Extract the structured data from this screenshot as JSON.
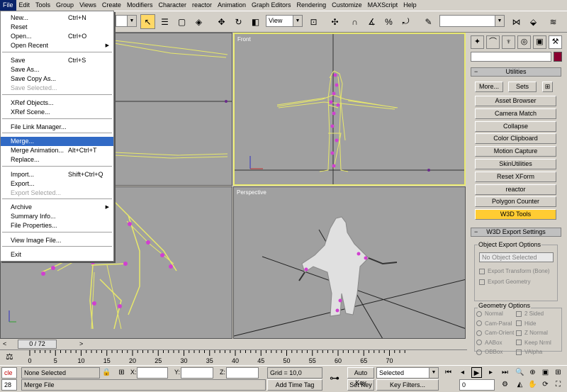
{
  "menubar": {
    "items": [
      "File",
      "Edit",
      "Tools",
      "Group",
      "Views",
      "Create",
      "Modifiers",
      "Character",
      "reactor",
      "Animation",
      "Graph Editors",
      "Rendering",
      "Customize",
      "MAXScript",
      "Help"
    ]
  },
  "toolbar": {
    "view_dropdown": "View"
  },
  "file_menu": {
    "items": [
      {
        "label": "New...",
        "shortcut": "Ctrl+N"
      },
      {
        "label": "Reset",
        "shortcut": ""
      },
      {
        "label": "Open...",
        "shortcut": "Ctrl+O"
      },
      {
        "label": "Open Recent",
        "shortcut": ""
      },
      {
        "label": "Save",
        "shortcut": "Ctrl+S"
      },
      {
        "label": "Save As...",
        "shortcut": ""
      },
      {
        "label": "Save Copy As...",
        "shortcut": ""
      },
      {
        "label": "Save Selected...",
        "shortcut": ""
      },
      {
        "label": "XRef Objects...",
        "shortcut": ""
      },
      {
        "label": "XRef Scene...",
        "shortcut": ""
      },
      {
        "label": "File Link Manager...",
        "shortcut": ""
      },
      {
        "label": "Merge...",
        "shortcut": ""
      },
      {
        "label": "Merge Animation...",
        "shortcut": "Alt+Ctrl+T"
      },
      {
        "label": "Replace...",
        "shortcut": ""
      },
      {
        "label": "Import...",
        "shortcut": "Shift+Ctrl+Q"
      },
      {
        "label": "Export...",
        "shortcut": ""
      },
      {
        "label": "Export Selected...",
        "shortcut": ""
      },
      {
        "label": "Archive",
        "shortcut": ""
      },
      {
        "label": "Summary Info...",
        "shortcut": ""
      },
      {
        "label": "File Properties...",
        "shortcut": ""
      },
      {
        "label": "View Image File...",
        "shortcut": ""
      },
      {
        "label": "Exit",
        "shortcut": ""
      }
    ]
  },
  "viewports": {
    "front_label": "Front",
    "perspective_label": "Perspective"
  },
  "command_panel": {
    "utilities_header": "Utilities",
    "more_button": "More...",
    "sets_button": "Sets",
    "utility_buttons": [
      "Asset Browser",
      "Camera Match",
      "Collapse",
      "Color Clipboard",
      "Motion Capture",
      "SkinUtilities",
      "Reset XForm",
      "reactor",
      "Polygon Counter",
      "W3D Tools"
    ],
    "w3d_header": "W3D Export Settings",
    "object_export_title": "Object Export Options",
    "no_selection": "No Object Selected",
    "export_transform": "Export Transform (Bone)",
    "export_geometry": "Export Geometry",
    "geometry_title": "Geometry Options",
    "geom_left": [
      "Normal",
      "Cam-Paral",
      "Cam-Orient",
      "AABox",
      "OBBox"
    ],
    "geom_right": [
      "2 Sided",
      "Hide",
      "Z Normal",
      "Keep Nrml",
      "VAlpha"
    ]
  },
  "timeline": {
    "thumb": "0 / 72",
    "ticks": [
      "0",
      "5",
      "10",
      "15",
      "20",
      "25",
      "30",
      "35",
      "40",
      "45",
      "50",
      "55",
      "60",
      "65",
      "70"
    ]
  },
  "status": {
    "listener_top": "cle",
    "listener_bottom": "28",
    "selection": "None Selected",
    "prompt": "Merge File",
    "x_label": "X:",
    "y_label": "Y:",
    "z_label": "Z:",
    "grid": "Grid = 10,0",
    "add_time_tag": "Add Time Tag",
    "auto_key": "Auto Key",
    "set_key": "Set Key",
    "selected_dropdown": "Selected",
    "key_filters": "Key Filters...",
    "frame": "0"
  },
  "colors": {
    "viewport_bg": "#a0a0a0",
    "wire": "#e8e86a",
    "bone": "#d040d0",
    "highlight": "#316ac5",
    "active_tool": "#ffcc33"
  }
}
